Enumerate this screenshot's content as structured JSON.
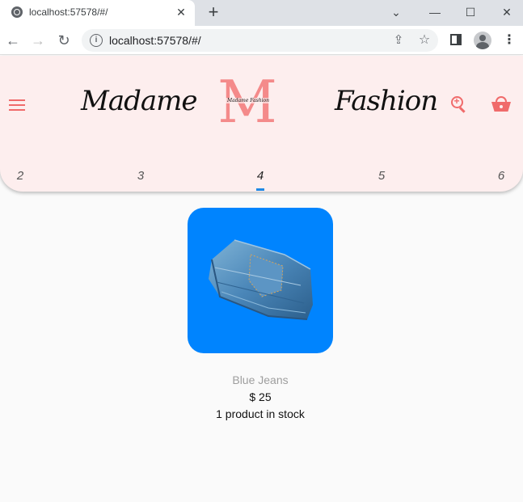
{
  "browser": {
    "tab_title": "localhost:57578/#/",
    "new_tab_label": "+",
    "close_label": "✕",
    "url": "localhost:57578/#/",
    "window_controls": {
      "minimize": "—",
      "maximize": "☐",
      "close": "✕"
    }
  },
  "header": {
    "brand_left": "Madame",
    "brand_right": "Fashion",
    "logo_letter": "M",
    "logo_script": "Madame Fashion",
    "accent_color": "#f06b6b",
    "background_color": "#fdeeee",
    "icons": [
      "menu-icon",
      "zoom-search-icon",
      "shopping-basket-icon"
    ]
  },
  "page_tabs": {
    "items": [
      "2",
      "3",
      "4",
      "5",
      "6"
    ],
    "active": "4",
    "indicator_color": "#1e88e5"
  },
  "product": {
    "name": "Blue Jeans",
    "price": "$ 25",
    "stock": "1 product in stock",
    "image_bg_color": "#0084fe"
  }
}
